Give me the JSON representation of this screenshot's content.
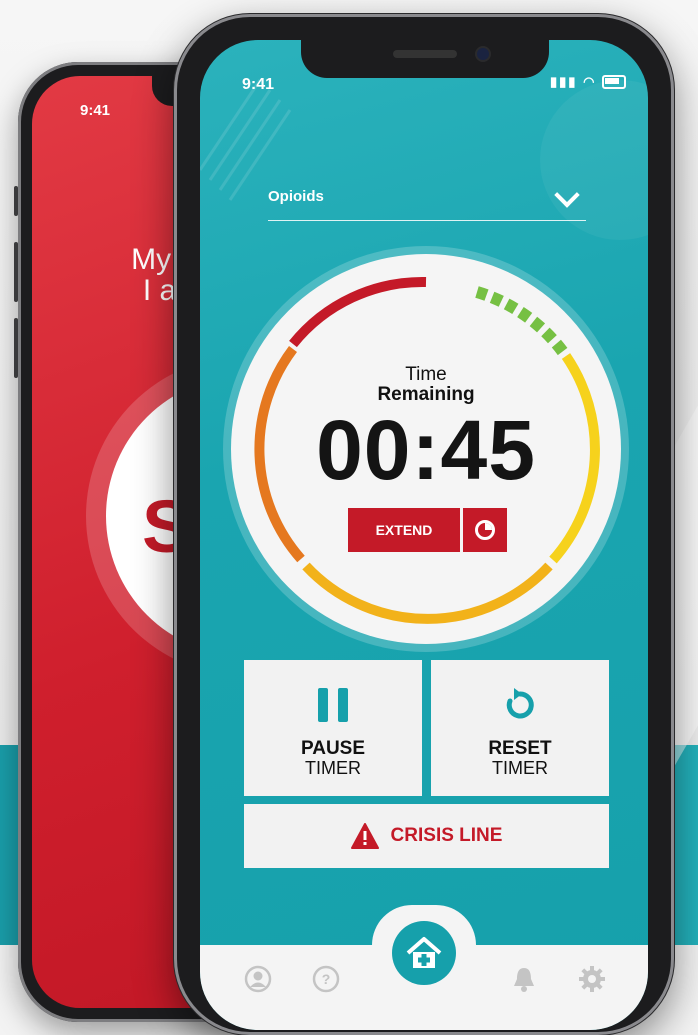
{
  "back_phone": {
    "status_time": "9:41",
    "greeting": "My na\nI am",
    "big_letter": "S",
    "accent_color": "#c41a28"
  },
  "front_phone": {
    "status_time": "9:41",
    "status_icons": [
      "signal-icon",
      "wifi-icon",
      "battery-icon"
    ],
    "category": {
      "selected": "Opioids",
      "icon": "chevron-down-icon"
    },
    "timer": {
      "label_line1": "Time",
      "label_line2": "Remaining",
      "countdown": "00:45",
      "extend_label": "EXTEND",
      "extend_icon": "clock-pie-icon",
      "ring_colors": [
        "#c41a28",
        "#e5781f",
        "#f2b21a",
        "#f6d21c",
        "#76c043"
      ]
    },
    "actions": {
      "pause": {
        "line1": "PAUSE",
        "line2": "TIMER",
        "icon": "pause-icon"
      },
      "reset": {
        "line1": "RESET",
        "line2": "TIMER",
        "icon": "reset-icon"
      },
      "crisis": {
        "label": "CRISIS LINE",
        "icon": "warning-icon"
      }
    },
    "bottom_nav": [
      {
        "name": "profile",
        "icon": "user-icon"
      },
      {
        "name": "help",
        "icon": "question-icon"
      },
      {
        "name": "home",
        "icon": "home-medical-icon"
      },
      {
        "name": "notifications",
        "icon": "bell-icon"
      },
      {
        "name": "settings",
        "icon": "gear-icon"
      }
    ],
    "theme": {
      "teal": "#16a0ab",
      "red": "#c41a28"
    }
  }
}
